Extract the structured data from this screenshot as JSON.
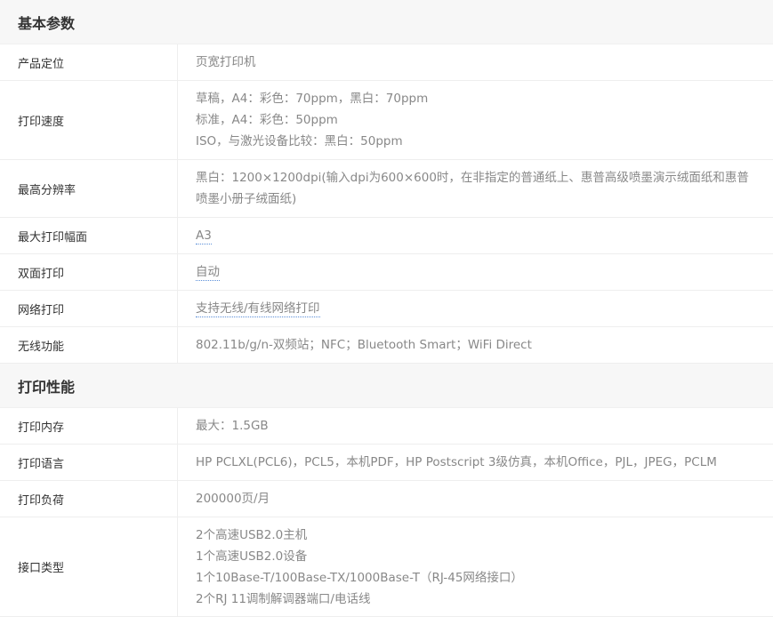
{
  "sections": [
    {
      "title": "基本参数",
      "rows": [
        {
          "label": "产品定位",
          "lines": [
            "页宽打印机"
          ]
        },
        {
          "label": "打印速度",
          "lines": [
            "草稿，A4：彩色：70ppm，黑白：70ppm",
            "标准，A4：彩色：50ppm",
            "ISO，与激光设备比较：黑白：50ppm"
          ]
        },
        {
          "label": "最高分辨率",
          "lines": [
            "黑白：1200×1200dpi(输入dpi为600×600时，在非指定的普通纸上、惠普高级喷墨演示绒面纸和惠普喷墨小册子绒面纸)"
          ]
        },
        {
          "label": "最大打印幅面",
          "lines": [
            "A3"
          ]
        },
        {
          "label": "双面打印",
          "lines": [
            "自动"
          ]
        },
        {
          "label": "网络打印",
          "lines": [
            "支持无线/有线网络打印"
          ]
        },
        {
          "label": "无线功能",
          "lines": [
            "802.11b/g/n-双频站；NFC；Bluetooth Smart；WiFi Direct"
          ]
        }
      ]
    },
    {
      "title": "打印性能",
      "rows": [
        {
          "label": "打印内存",
          "lines": [
            "最大：1.5GB"
          ]
        },
        {
          "label": "打印语言",
          "lines": [
            "HP PCLXL(PCL6)，PCL5，本机PDF，HP Postscript 3级仿真，本机Office，PJL，JPEG，PCLM"
          ]
        },
        {
          "label": "打印负荷",
          "lines": [
            "200000页/月"
          ]
        },
        {
          "label": "接口类型",
          "lines": [
            "2个高速USB2.0主机",
            "1个高速USB2.0设备",
            "1个10Base-T/100Base-TX/1000Base-T（RJ-45网络接口）",
            "2个RJ 11调制解调器端口/电话线"
          ]
        }
      ]
    }
  ]
}
